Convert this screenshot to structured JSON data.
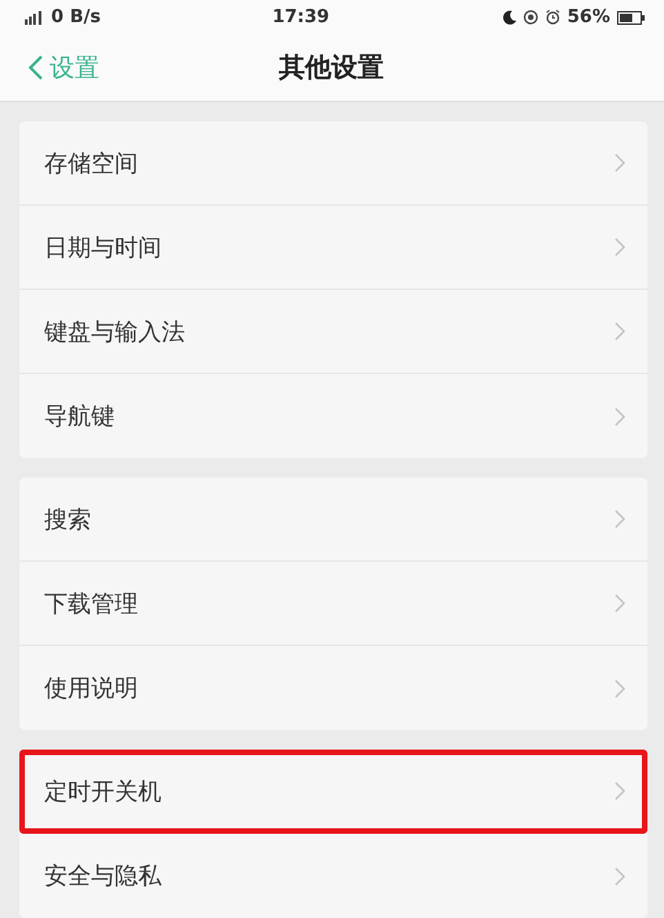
{
  "status_bar": {
    "network_speed": "0 B/s",
    "time": "17:39",
    "battery": "56%"
  },
  "header": {
    "back_label": "设置",
    "title": "其他设置"
  },
  "groups": [
    {
      "items": [
        {
          "label": "存储空间",
          "highlighted": false
        },
        {
          "label": "日期与时间",
          "highlighted": false
        },
        {
          "label": "键盘与输入法",
          "highlighted": false
        },
        {
          "label": "导航键",
          "highlighted": false
        }
      ]
    },
    {
      "items": [
        {
          "label": "搜索",
          "highlighted": false
        },
        {
          "label": "下载管理",
          "highlighted": false
        },
        {
          "label": "使用说明",
          "highlighted": false
        }
      ]
    },
    {
      "items": [
        {
          "label": "定时开关机",
          "highlighted": true
        },
        {
          "label": "安全与隐私",
          "highlighted": false
        }
      ]
    }
  ]
}
